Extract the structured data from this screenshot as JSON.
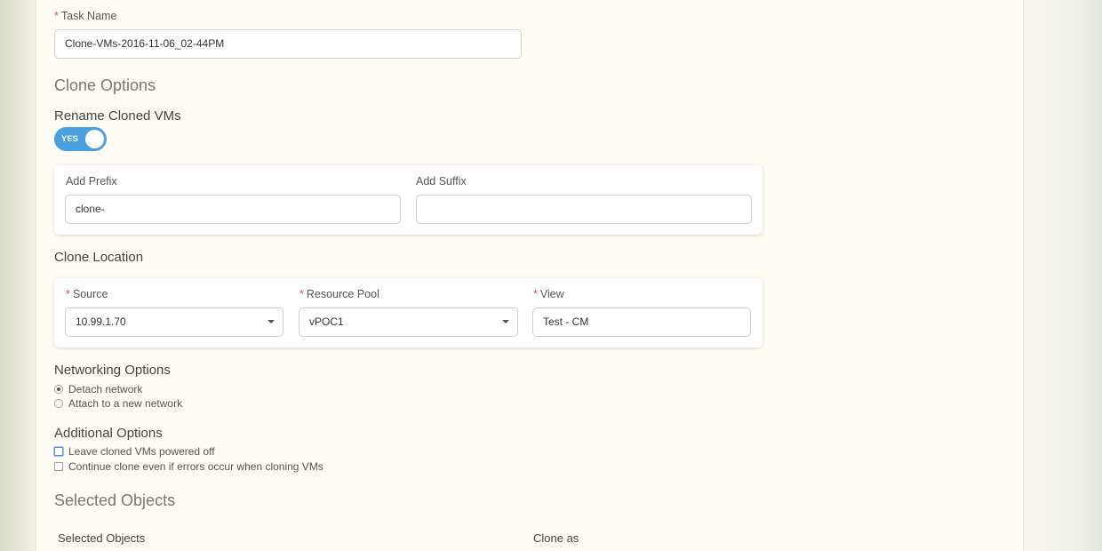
{
  "task": {
    "label": "Task Name",
    "value": "Clone-VMs-2016-11-06_02-44PM"
  },
  "clone_options": {
    "title": "Clone Options",
    "rename_title": "Rename Cloned VMs",
    "toggle_label": "YES",
    "toggle_on": true,
    "prefix": {
      "label": "Add Prefix",
      "value": "clone-"
    },
    "suffix": {
      "label": "Add Suffix",
      "value": ""
    }
  },
  "clone_location": {
    "title": "Clone Location",
    "source": {
      "label": "Source",
      "value": "10.99.1.70"
    },
    "resource_pool": {
      "label": "Resource Pool",
      "value": "vPOC1"
    },
    "view": {
      "label": "View",
      "value": "Test - CM"
    }
  },
  "networking": {
    "title": "Networking Options",
    "options": [
      {
        "label": "Detach network",
        "selected": true
      },
      {
        "label": "Attach to a new network",
        "selected": false
      }
    ]
  },
  "additional": {
    "title": "Additional Options",
    "options": [
      {
        "label": "Leave cloned VMs powered off",
        "checked": false
      },
      {
        "label": "Continue clone even if errors occur when cloning VMs",
        "checked": false
      }
    ]
  },
  "selected_objects": {
    "title": "Selected Objects",
    "columns": [
      "Selected Objects",
      "Clone as"
    ]
  },
  "colors": {
    "accent": "#4a9fde",
    "required": "#d9534f"
  }
}
